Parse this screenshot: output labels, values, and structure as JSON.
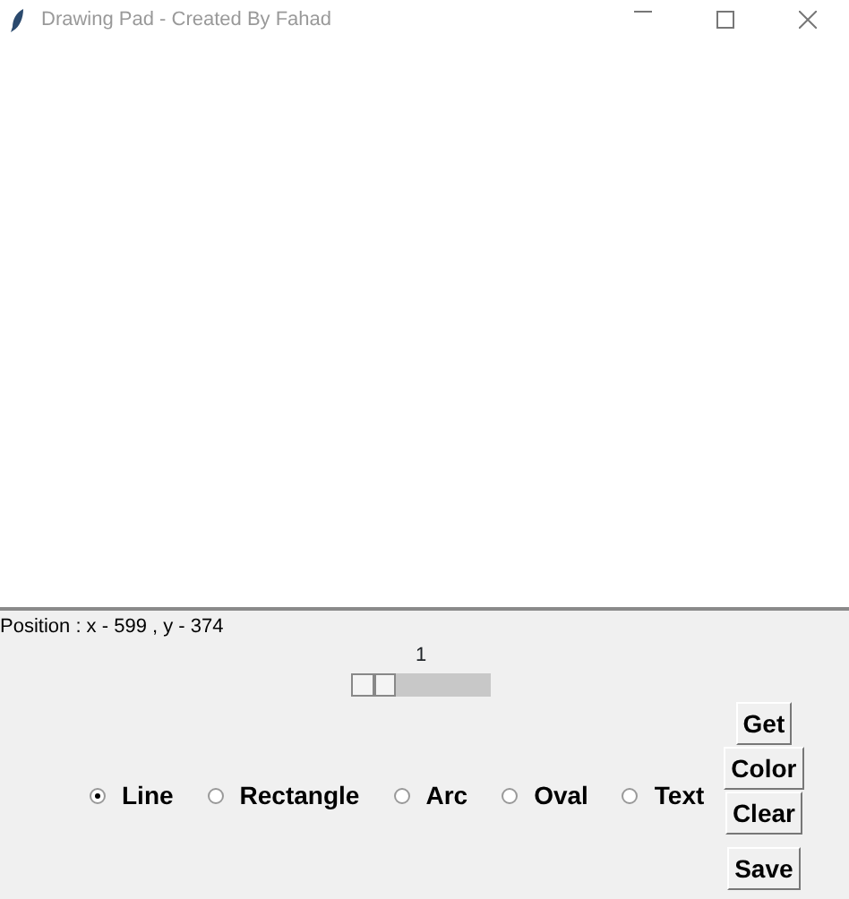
{
  "window": {
    "title": "Drawing Pad - Created By Fahad"
  },
  "status_bar": "Position : x - 599 , y - 374",
  "size_slider": {
    "value": "1"
  },
  "tools": [
    {
      "label": "Line",
      "selected": true
    },
    {
      "label": "Rectangle",
      "selected": false
    },
    {
      "label": "Arc",
      "selected": false
    },
    {
      "label": "Oval",
      "selected": false
    },
    {
      "label": "Text",
      "selected": false
    }
  ],
  "buttons": [
    "Get",
    "Color",
    "Clear",
    "Save"
  ]
}
